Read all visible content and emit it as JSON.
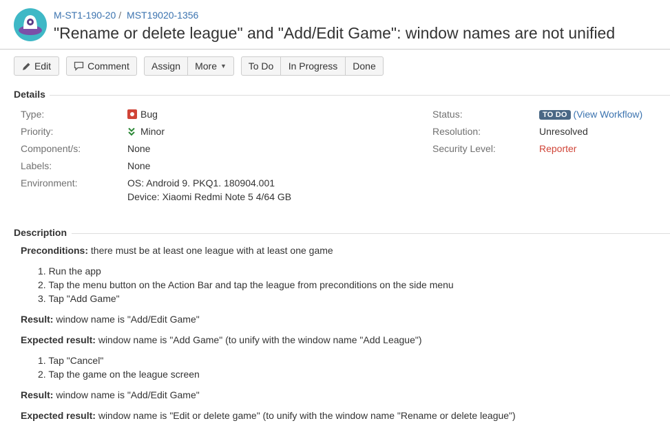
{
  "breadcrumb": {
    "project": "M-ST1-190-20",
    "separator": "/",
    "issue_key": "MST19020-1356"
  },
  "summary": "\"Rename or delete league\" and \"Add/Edit Game\": window names are not unified",
  "toolbar": {
    "edit": "Edit",
    "comment": "Comment",
    "assign": "Assign",
    "more": "More",
    "todo": "To Do",
    "in_progress": "In Progress",
    "done": "Done"
  },
  "details": {
    "heading": "Details",
    "type_label": "Type:",
    "type_value": "Bug",
    "priority_label": "Priority:",
    "priority_value": "Minor",
    "components_label": "Component/s:",
    "components_value": "None",
    "labels_label": "Labels:",
    "labels_value": "None",
    "environment_label": "Environment:",
    "environment_lines": [
      "OS: Android 9. PKQ1. 180904.001",
      "Device: Xiaomi Redmi Note 5 4/64 GB"
    ],
    "status_label": "Status:",
    "status_value": "TO DO",
    "workflow_open": "(",
    "workflow_link": "View Workflow",
    "workflow_close": ")",
    "resolution_label": "Resolution:",
    "resolution_value": "Unresolved",
    "security_label": "Security Level:",
    "security_value": "Reporter"
  },
  "description": {
    "heading": "Description",
    "preconditions_label": "Preconditions:",
    "preconditions_text": "there must be at least one league with at least one game",
    "steps1": [
      "1. Run the app",
      "2. Tap the menu button on the Action Bar and tap the league from preconditions on the side menu",
      "3. Tap \"Add Game\""
    ],
    "result_label": "Result:",
    "result1_text": "window name is \"Add/Edit Game\"",
    "expected_label": "Expected result:",
    "expected1_text": "window name is \"Add Game\" (to unify with the window name \"Add League\")",
    "steps2": [
      "1. Tap \"Cancel\"",
      "2. Tap the game on the league screen"
    ],
    "result2_text": "window name is \"Add/Edit Game\"",
    "expected2_text": "window name is \"Edit or delete game\" (to unify with the window name \"Rename or delete league\")"
  },
  "colors": {
    "link": "#3b73af",
    "bug": "#d04437",
    "lozenge": "#4a6785",
    "priority_minor": "#2a8735"
  }
}
